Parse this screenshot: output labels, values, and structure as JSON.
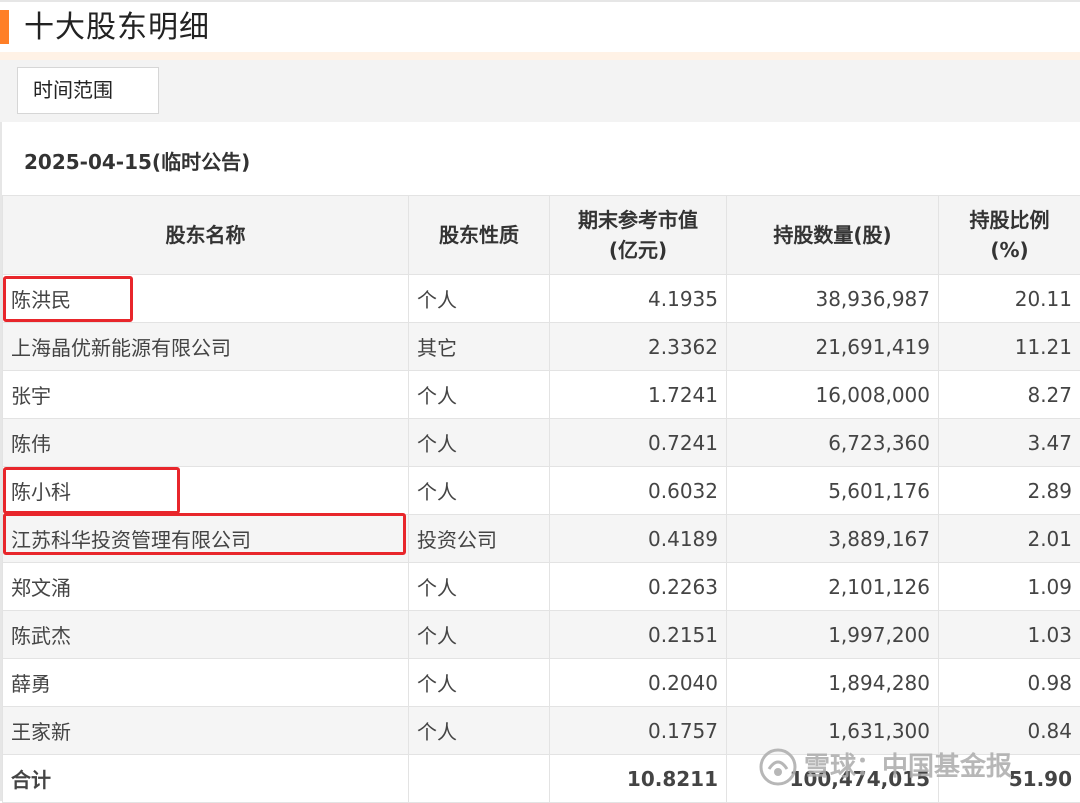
{
  "header": {
    "title": "十大股东明细",
    "accent_color": "#ff7f27"
  },
  "filter": {
    "time_range_label": "时间范围"
  },
  "report": {
    "date_label": "2025-04-15(临时公告)"
  },
  "table": {
    "columns": [
      {
        "line1": "股东名称",
        "line2": ""
      },
      {
        "line1": "股东性质",
        "line2": ""
      },
      {
        "line1": "期末参考市值",
        "line2": "(亿元)"
      },
      {
        "line1": "持股数量(股)",
        "line2": ""
      },
      {
        "line1": "持股比例",
        "line2": "(%)"
      }
    ],
    "rows": [
      {
        "name": "陈洪民",
        "type": "个人",
        "value": "4.1935",
        "shares": "38,936,987",
        "ratio": "20.11"
      },
      {
        "name": "上海晶优新能源有限公司",
        "type": "其它",
        "value": "2.3362",
        "shares": "21,691,419",
        "ratio": "11.21"
      },
      {
        "name": "张宇",
        "type": "个人",
        "value": "1.7241",
        "shares": "16,008,000",
        "ratio": "8.27"
      },
      {
        "name": "陈伟",
        "type": "个人",
        "value": "0.7241",
        "shares": "6,723,360",
        "ratio": "3.47"
      },
      {
        "name": "陈小科",
        "type": "个人",
        "value": "0.6032",
        "shares": "5,601,176",
        "ratio": "2.89"
      },
      {
        "name": "江苏科华投资管理有限公司",
        "type": "投资公司",
        "value": "0.4189",
        "shares": "3,889,167",
        "ratio": "2.01"
      },
      {
        "name": "郑文涌",
        "type": "个人",
        "value": "0.2263",
        "shares": "2,101,126",
        "ratio": "1.09"
      },
      {
        "name": "陈武杰",
        "type": "个人",
        "value": "0.2151",
        "shares": "1,997,200",
        "ratio": "1.03"
      },
      {
        "name": "薛勇",
        "type": "个人",
        "value": "0.2040",
        "shares": "1,894,280",
        "ratio": "0.98"
      },
      {
        "name": "王家新",
        "type": "个人",
        "value": "0.1757",
        "shares": "1,631,300",
        "ratio": "0.84"
      }
    ],
    "total": {
      "label": "合计",
      "type": "",
      "value": "10.8211",
      "shares": "100,474,015",
      "ratio": "51.90"
    }
  },
  "watermark": {
    "text": "雪球：中国基金报"
  },
  "colors": {
    "highlight_box": "#e8262b",
    "header_bg": "#f4f4f4",
    "stripe_bg": "#f5f5f5"
  }
}
